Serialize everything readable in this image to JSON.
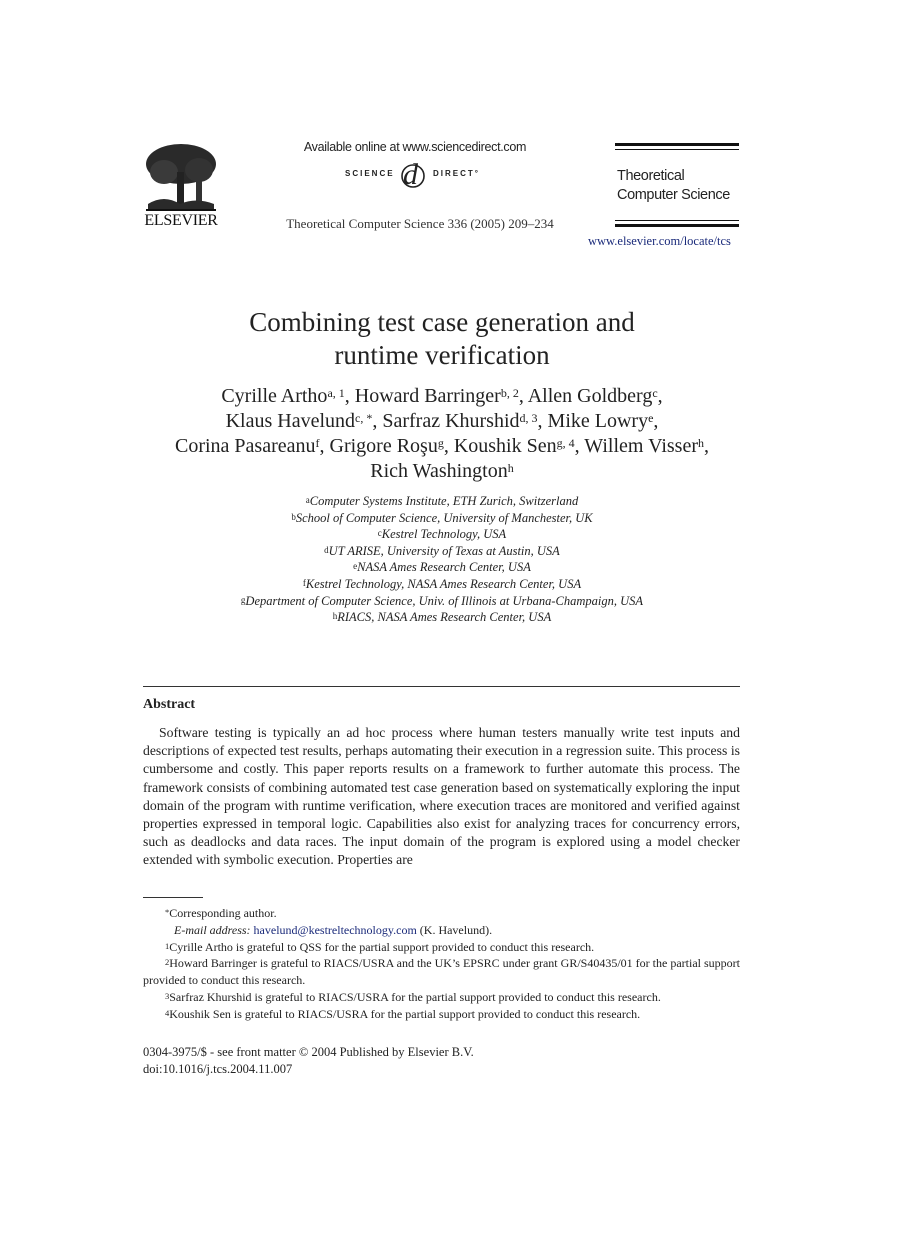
{
  "header": {
    "publisher": "ELSEVIER",
    "available_online": "Available online at www.sciencedirect.com",
    "sciencedirect_left": "SCIENCE",
    "sciencedirect_mark": "d",
    "sciencedirect_right": "DIRECT°",
    "journal_ref": "Theoretical Computer Science 336 (2005) 209–234",
    "journal_name_line1": "Theoretical",
    "journal_name_line2": "Computer Science",
    "journal_url": "www.elsevier.com/locate/tcs"
  },
  "title": {
    "line1": "Combining test case generation and",
    "line2": "runtime verification"
  },
  "authors": [
    {
      "name": "Cyrille Artho",
      "sup": "a, 1",
      "sep": ", "
    },
    {
      "name": "Howard Barringer",
      "sup": "b, 2",
      "sep": ", "
    },
    {
      "name": "Allen Goldberg",
      "sup": "c",
      "sep": ","
    },
    {
      "name": "Klaus Havelund",
      "sup": "c, *",
      "sep": ", "
    },
    {
      "name": "Sarfraz Khurshid",
      "sup": "d, 3",
      "sep": ", "
    },
    {
      "name": "Mike Lowry",
      "sup": "e",
      "sep": ","
    },
    {
      "name": "Corina Pasareanu",
      "sup": "f",
      "sep": ", "
    },
    {
      "name": "Grigore Roşu",
      "sup": "g",
      "sep": ", "
    },
    {
      "name": "Koushik Sen",
      "sup": "g, 4",
      "sep": ", "
    },
    {
      "name": "Willem Visser",
      "sup": "h",
      "sep": ","
    },
    {
      "name": "Rich Washington",
      "sup": "h",
      "sep": ""
    }
  ],
  "affiliations": [
    {
      "key": "a",
      "text": "Computer Systems Institute, ETH Zurich, Switzerland"
    },
    {
      "key": "b",
      "text": "School of Computer Science, University of Manchester, UK"
    },
    {
      "key": "c",
      "text": "Kestrel Technology, USA"
    },
    {
      "key": "d",
      "text": "UT ARISE, University of Texas at Austin, USA"
    },
    {
      "key": "e",
      "text": "NASA Ames Research Center, USA"
    },
    {
      "key": "f",
      "text": "Kestrel Technology, NASA Ames Research Center, USA"
    },
    {
      "key": "g",
      "text": "Department of Computer Science, Univ. of Illinois at Urbana-Champaign, USA"
    },
    {
      "key": "h",
      "text": "RIACS, NASA Ames Research Center, USA"
    }
  ],
  "abstract": {
    "heading": "Abstract",
    "body": "Software  testing is typically an ad hoc process where human testers manually write test inputs and descriptions of expected test results, perhaps automating their execution in a regression suite. This process is cumbersome and costly. This paper reports results on a framework to further automate this process. The framework consists of combining automated test case generation based on systematically exploring the input domain of the program with runtime verification, where execution traces are monitored and verified against properties expressed in temporal logic. Capabilities also exist for analyzing traces for concurrency errors, such as deadlocks and data races. The input domain of the program is explored using a model checker extended with symbolic execution. Properties are"
  },
  "footnotes": {
    "corresponding_mark": "*",
    "corresponding": "Corresponding author.",
    "email_label": "E-mail address:",
    "email": "havelund@kestreltechnology.com",
    "email_owner": "(K. Havelund).",
    "notes": [
      {
        "key": "1",
        "text": "Cyrille Artho is grateful to QSS for the partial support provided to conduct this research."
      },
      {
        "key": "2",
        "text": "Howard Barringer is grateful to RIACS/USRA and the UK’s EPSRC under grant GR/S40435/01 for the partial support provided to conduct this research."
      },
      {
        "key": "3",
        "text": "Sarfraz Khurshid is grateful to RIACS/USRA for the partial support provided to conduct this research."
      },
      {
        "key": "4",
        "text": "Koushik Sen is grateful to RIACS/USRA for the partial support provided to conduct this research."
      }
    ]
  },
  "front_matter": {
    "issn_line": "0304-3975/$ - see front matter © 2004 Published by Elsevier B.V.",
    "doi": "doi:10.1016/j.tcs.2004.11.007"
  }
}
